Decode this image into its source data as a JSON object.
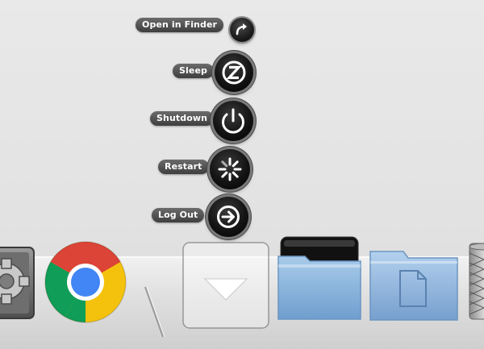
{
  "stack_menu": {
    "items": [
      {
        "label": "Open in Finder",
        "icon": "arrow-curved-icon"
      },
      {
        "label": "Sleep",
        "icon": "sleep-z-icon"
      },
      {
        "label": "Shutdown",
        "icon": "power-icon"
      },
      {
        "label": "Restart",
        "icon": "spinner-icon"
      },
      {
        "label": "Log Out",
        "icon": "arrow-right-circle-icon"
      }
    ]
  },
  "dock": {
    "items": [
      {
        "icon": "system-preferences-icon"
      },
      {
        "icon": "chrome-icon"
      },
      {
        "icon": "dock-separator"
      },
      {
        "icon": "stack-expand-chevron-icon"
      },
      {
        "icon": "folder-open-icon"
      },
      {
        "icon": "documents-folder-icon"
      },
      {
        "icon": "trash-icon"
      }
    ]
  },
  "colors": {
    "pill_background": "#4a4a4a",
    "orb_background": "#111111",
    "folder_blue": "#8fb7de",
    "chrome_red": "#db4437",
    "chrome_yellow": "#f4c20d",
    "chrome_green": "#0f9d58",
    "chrome_blue": "#4285f4"
  }
}
